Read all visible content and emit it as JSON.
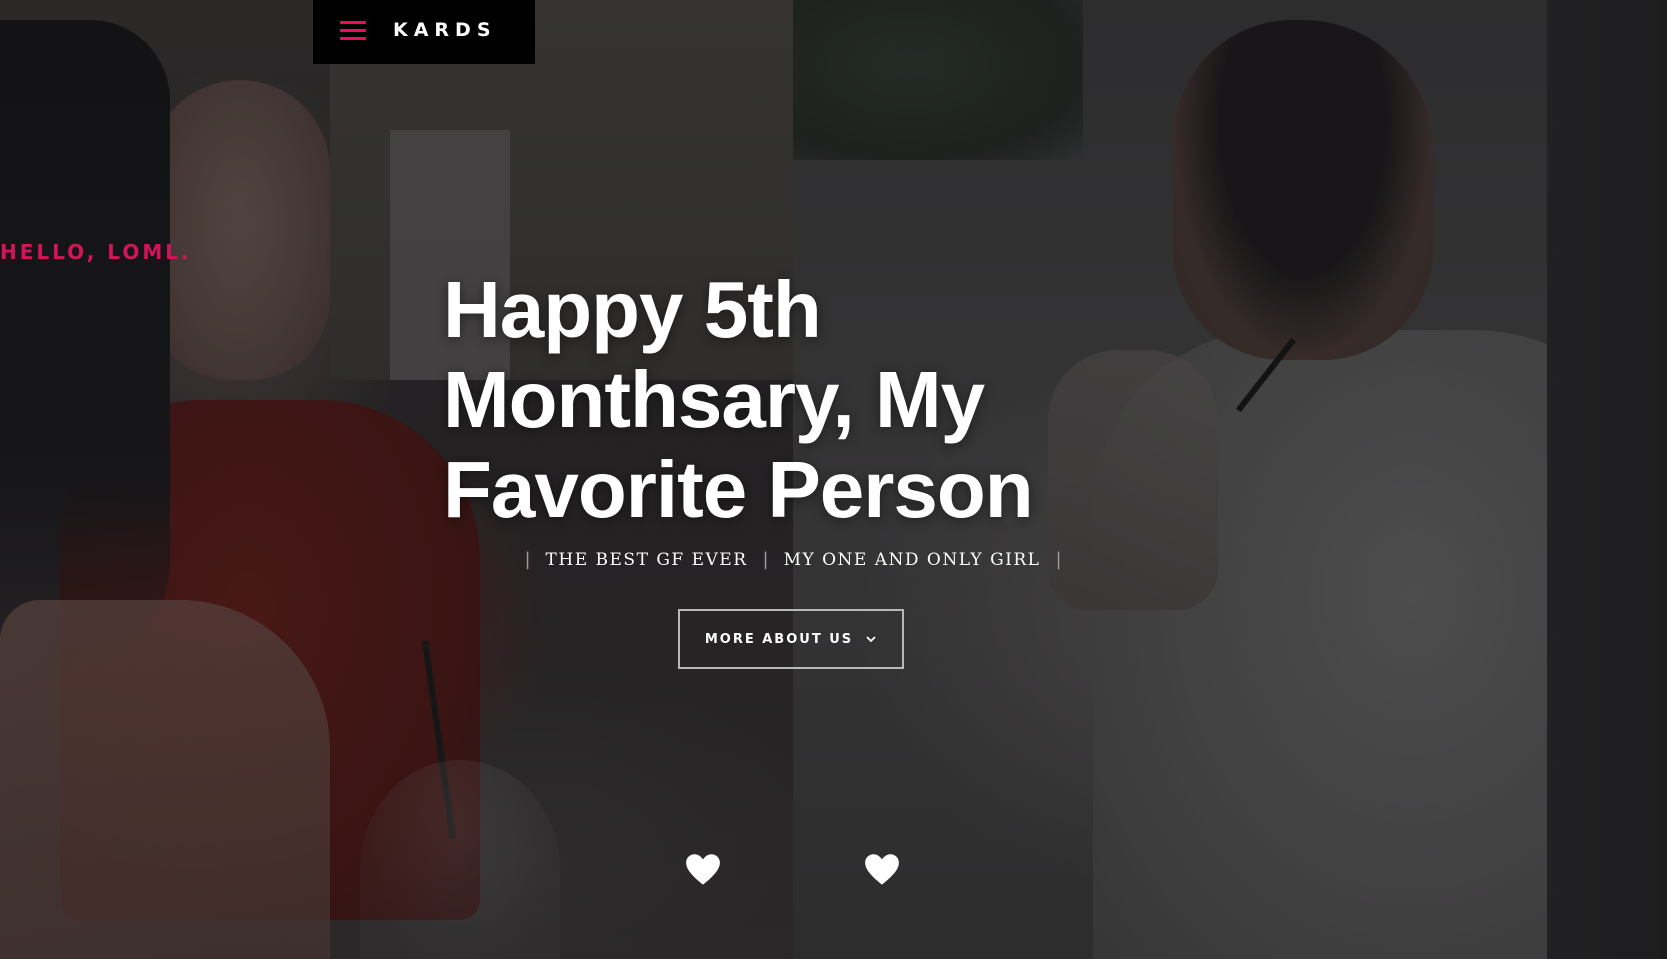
{
  "brand": {
    "name": "KARDS",
    "menu_icon": "hamburger-icon",
    "accent_color": "#e0135e"
  },
  "hero": {
    "greeting": "HELLO, LOML.",
    "headline": "Happy 5th Monthsary, My Favorite Person",
    "taglines": [
      "THE BEST GF EVER",
      "MY ONE AND ONLY GIRL"
    ],
    "separator": "|",
    "cta_label": "MORE ABOUT US",
    "cta_icon": "chevron-down-icon"
  },
  "decor": {
    "hearts": [
      "heart-icon",
      "heart-icon"
    ]
  }
}
